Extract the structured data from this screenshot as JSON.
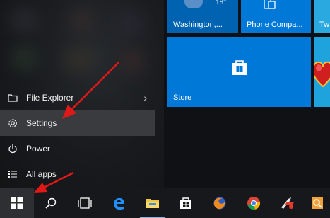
{
  "start_menu": {
    "items": [
      {
        "label": "File Explorer",
        "icon": "folder-icon",
        "has_submenu": true
      },
      {
        "label": "Settings",
        "icon": "gear-icon",
        "highlighted": true
      },
      {
        "label": "Power",
        "icon": "power-icon"
      },
      {
        "label": "All apps",
        "icon": "list-icon"
      }
    ],
    "highlight_color": "#3a3b3e"
  },
  "tiles": {
    "weather": {
      "label": "Washington,...",
      "temp": "18°",
      "color": "#0063b1"
    },
    "phone_companion": {
      "label": "Phone Compa...",
      "color": "#0078d7"
    },
    "twitter": {
      "label": "Tw",
      "color": "#2aa9e0"
    },
    "store": {
      "label": "Store",
      "color": "#0078d7"
    },
    "heart_game": {
      "color": "#1fa3dd"
    }
  },
  "taskbar": {
    "apps": [
      "start-icon",
      "search-icon",
      "task-view-icon",
      "edge-icon",
      "file-explorer-icon",
      "store-icon",
      "firefox-icon",
      "chrome-icon",
      "ccleaner-icon",
      "search-app-icon"
    ],
    "background": "#17181b"
  },
  "annotations": {
    "arrow_color": "#e11818",
    "count": 2
  }
}
